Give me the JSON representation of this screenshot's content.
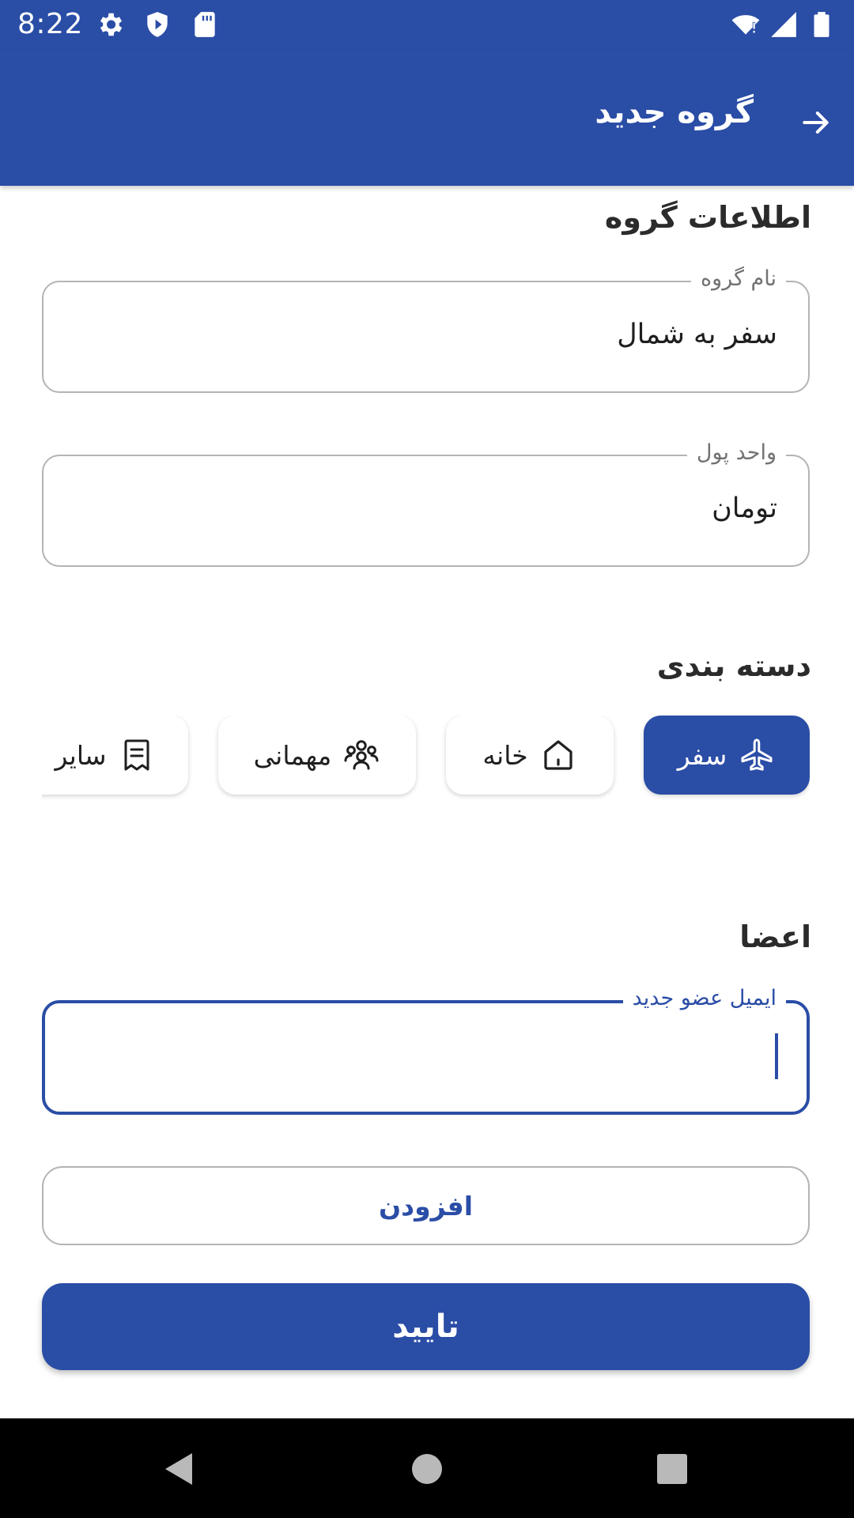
{
  "status_bar": {
    "time": "8:22",
    "left_icons": [
      "settings-icon",
      "shield-icon",
      "sd-card-icon"
    ],
    "right_icons": [
      "wifi-icon",
      "signal-icon",
      "battery-icon"
    ]
  },
  "app_bar": {
    "title": "گروه جدید",
    "back_icon": "arrow-right-icon"
  },
  "group_info": {
    "title": "اطلاعات گروه",
    "name_field": {
      "label": "نام گروه",
      "value": "سفر به شمال"
    },
    "currency_field": {
      "label": "واحد پول",
      "value": "تومان"
    }
  },
  "category": {
    "title": "دسته بندی",
    "chips": [
      {
        "label": "سفر",
        "icon": "airplane-icon",
        "selected": true
      },
      {
        "label": "خانه",
        "icon": "home-icon",
        "selected": false
      },
      {
        "label": "مهمانی",
        "icon": "people-icon",
        "selected": false
      },
      {
        "label": "سایر",
        "icon": "receipt-icon",
        "selected": false
      }
    ]
  },
  "members": {
    "title": "اعضا",
    "email_field": {
      "label": "ایمیل عضو جدید",
      "value": ""
    },
    "add_button": "افزودن",
    "confirm_button": "تایید"
  },
  "colors": {
    "primary": "#2a4da6",
    "outline": "#b4b4b4",
    "nav_bar": "#000000"
  }
}
